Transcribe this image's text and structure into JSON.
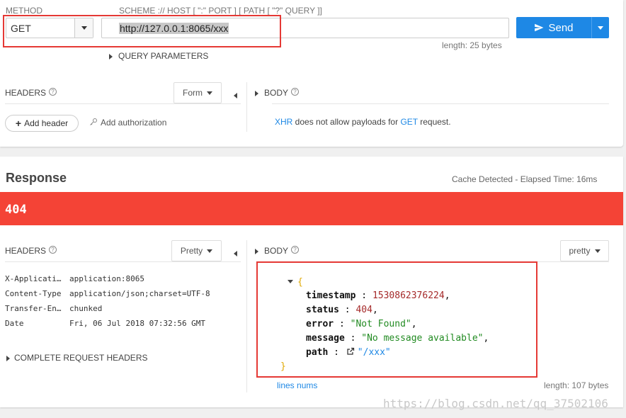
{
  "request": {
    "method_label": "METHOD",
    "url_hint": "SCHEME :// HOST [ \":\" PORT ] [ PATH [ \"?\" QUERY ]]",
    "method": "GET",
    "url": "http://127.0.0.1:8065/xxx",
    "send_label": "Send",
    "length": "length: 25 bytes",
    "query_params_label": "QUERY PARAMETERS",
    "headers_label": "HEADERS",
    "headers_mode": "Form",
    "body_label": "BODY",
    "add_header_label": "Add header",
    "add_auth_label": "Add authorization",
    "xhr_note": {
      "xhr": "XHR",
      "middle": " does not allow payloads for ",
      "method": "GET",
      "end": " request."
    }
  },
  "response": {
    "title": "Response",
    "cache_info": "Cache Detected - Elapsed Time: 16ms",
    "status_code": "404",
    "headers_label": "HEADERS",
    "headers_mode": "Pretty",
    "body_label": "BODY",
    "body_mode": "pretty",
    "headers": [
      {
        "key": "X-Application-Context",
        "value": "application:8065"
      },
      {
        "key": "Content-Type",
        "value": "application/json;charset=UTF-8"
      },
      {
        "key": "Transfer-Encoding",
        "value": "chunked"
      },
      {
        "key": "Date",
        "value": "Fri, 06 Jul 2018 07:32:56 GMT"
      }
    ],
    "complete_headers_label": "COMPLETE REQUEST HEADERS",
    "body": {
      "open_brace": "{",
      "close_brace": "}",
      "timestamp_key": "timestamp",
      "timestamp_val": "1530862376224",
      "status_key": "status",
      "status_val": "404",
      "error_key": "error",
      "error_val": "\"Not Found\"",
      "message_key": "message",
      "message_val": "\"No message available\"",
      "path_key": "path",
      "path_val": "\"/xxx\""
    },
    "lines_nums_label": "lines nums",
    "length": "length: 107 bytes"
  },
  "watermark": "https://blog.csdn.net/qq_37502106",
  "colors": {
    "accent": "#1e88e5",
    "error": "#f44336",
    "highlight_box": "#e53935"
  }
}
